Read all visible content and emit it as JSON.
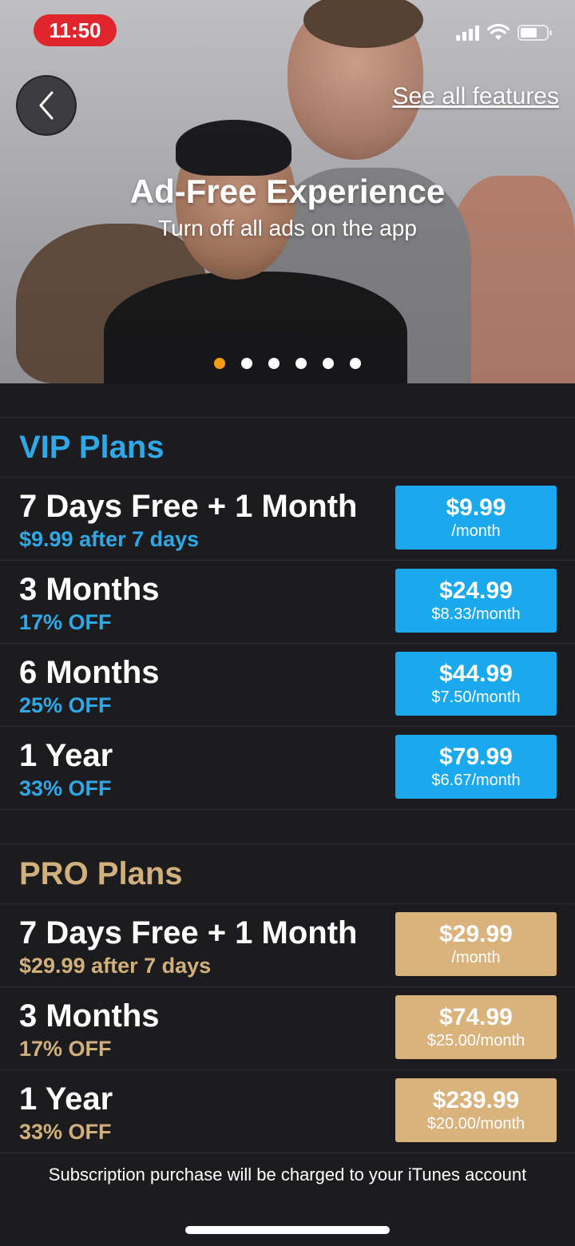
{
  "status_bar": {
    "time": "11:50"
  },
  "header": {
    "see_all_label": "See all features"
  },
  "hero": {
    "title": "Ad-Free Experience",
    "subtitle": "Turn off all ads on the app",
    "active_dot": 1,
    "dot_count": 6
  },
  "vip": {
    "title": "VIP Plans",
    "color": "#1aa9ec",
    "plans": [
      {
        "name": "7 Days Free + 1 Month",
        "sub": "$9.99 after 7 days",
        "price": "$9.99",
        "per": "/month"
      },
      {
        "name": "3 Months",
        "sub": "17% OFF",
        "price": "$24.99",
        "per": "$8.33/month"
      },
      {
        "name": "6 Months",
        "sub": "25% OFF",
        "price": "$44.99",
        "per": "$7.50/month"
      },
      {
        "name": "1 Year",
        "sub": "33% OFF",
        "price": "$79.99",
        "per": "$6.67/month"
      }
    ]
  },
  "pro": {
    "title": "PRO Plans",
    "color": "#d9b27c",
    "plans": [
      {
        "name": "7 Days Free + 1 Month",
        "sub": "$29.99 after 7 days",
        "price": "$29.99",
        "per": "/month"
      },
      {
        "name": "3 Months",
        "sub": "17% OFF",
        "price": "$74.99",
        "per": "$25.00/month"
      },
      {
        "name": "1 Year",
        "sub": "33% OFF",
        "price": "$239.99",
        "per": "$20.00/month"
      }
    ]
  },
  "footer": {
    "text": "Subscription purchase will be charged to your iTunes account"
  },
  "colors": {
    "accent_active_dot": "#f39c12",
    "status_time_bg": "#e0262c",
    "background": "#1c1c1e"
  }
}
